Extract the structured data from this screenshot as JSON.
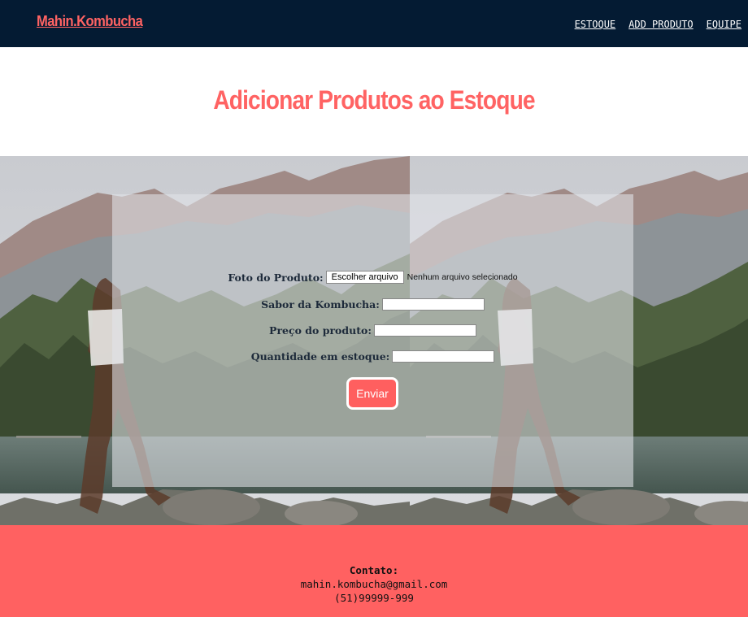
{
  "header": {
    "brand": "Mahin.Kombucha",
    "nav": [
      "ESTOQUE",
      "ADD PRODUTO",
      "EQUIPE"
    ]
  },
  "page": {
    "title": "Adicionar Produtos ao Estoque"
  },
  "form": {
    "photo_label": "Foto do Produto:",
    "file_button": "Escolher arquivo",
    "file_status": "Nenhum arquivo selecionado",
    "flavor_label": "Sabor da Kombucha:",
    "flavor_value": "",
    "price_label": "Preço do produto:",
    "price_value": "",
    "quantity_label": "Quantidade em estoque:",
    "quantity_value": "",
    "submit": "Enviar"
  },
  "footer": {
    "contact_title": "Contato:",
    "email": "mahin.kombucha@gmail.com",
    "phone": "(51)99999-999"
  },
  "colors": {
    "header_bg": "#041b33",
    "accent": "#ff6363",
    "footer_bg": "#ff6161"
  }
}
